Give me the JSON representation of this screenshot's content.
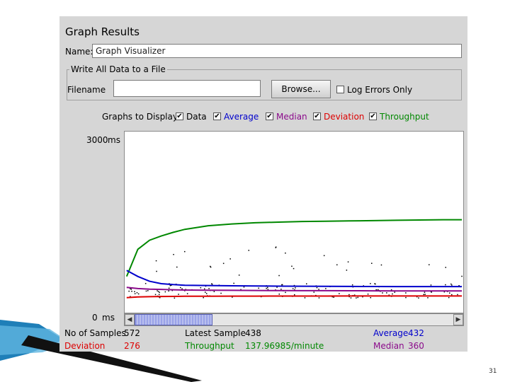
{
  "window": {
    "title": "Graph Results"
  },
  "name_field": {
    "label": "Name:",
    "value": "Graph Visualizer"
  },
  "file_group": {
    "legend": "Write All Data to a File",
    "filename_label": "Filename",
    "filename_value": "",
    "browse_label": "Browse...",
    "log_errors_label": "Log Errors Only",
    "log_errors_checked": false
  },
  "graphs_to_display": {
    "label": "Graphs to Display",
    "options": [
      {
        "label": "Data",
        "checked": true,
        "color": "#000000"
      },
      {
        "label": "Average",
        "checked": true,
        "color": "#0000cc"
      },
      {
        "label": "Median",
        "checked": true,
        "color": "#8b0a8b"
      },
      {
        "label": "Deviation",
        "checked": true,
        "color": "#dd0000"
      },
      {
        "label": "Throughput",
        "checked": true,
        "color": "#008800"
      }
    ]
  },
  "axis": {
    "top_label": "3000",
    "top_unit": "ms",
    "bottom_label": "0",
    "bottom_unit": "ms"
  },
  "stats": {
    "no_of_samples_label": "No of Samples",
    "no_of_samples_value": "572",
    "latest_sample_label": "Latest Sample",
    "latest_sample_value": "438",
    "average_label": "Average",
    "average_value": "432",
    "deviation_label": "Deviation",
    "deviation_value": "276",
    "throughput_label": "Throughput",
    "throughput_value": "137.96985/minute",
    "median_label": "Median",
    "median_value": "360"
  },
  "slide": {
    "page_number": "31"
  },
  "chart_data": {
    "type": "line",
    "ylim": [
      0,
      3000
    ],
    "y_unit": "ms",
    "x": [
      1,
      20,
      40,
      60,
      80,
      100,
      140,
      180,
      220,
      260,
      300,
      340,
      380,
      420,
      460,
      500,
      540,
      572
    ],
    "series": [
      {
        "name": "Throughput",
        "color": "#008800",
        "values": [
          600,
          1050,
          1200,
          1270,
          1330,
          1380,
          1440,
          1470,
          1490,
          1500,
          1510,
          1515,
          1520,
          1525,
          1530,
          1535,
          1540,
          1540
        ]
      },
      {
        "name": "Average",
        "color": "#0000cc",
        "values": [
          700,
          600,
          520,
          480,
          465,
          455,
          450,
          445,
          442,
          440,
          438,
          436,
          435,
          434,
          433,
          433,
          432,
          432
        ]
      },
      {
        "name": "Median",
        "color": "#8b0a8b",
        "values": [
          420,
          400,
          390,
          385,
          380,
          375,
          372,
          370,
          368,
          366,
          365,
          364,
          363,
          362,
          361,
          361,
          360,
          360
        ]
      },
      {
        "name": "Deviation",
        "color": "#dd0000",
        "values": [
          250,
          260,
          265,
          268,
          270,
          272,
          273,
          274,
          274,
          275,
          275,
          275,
          276,
          276,
          276,
          276,
          276,
          276
        ]
      }
    ]
  }
}
